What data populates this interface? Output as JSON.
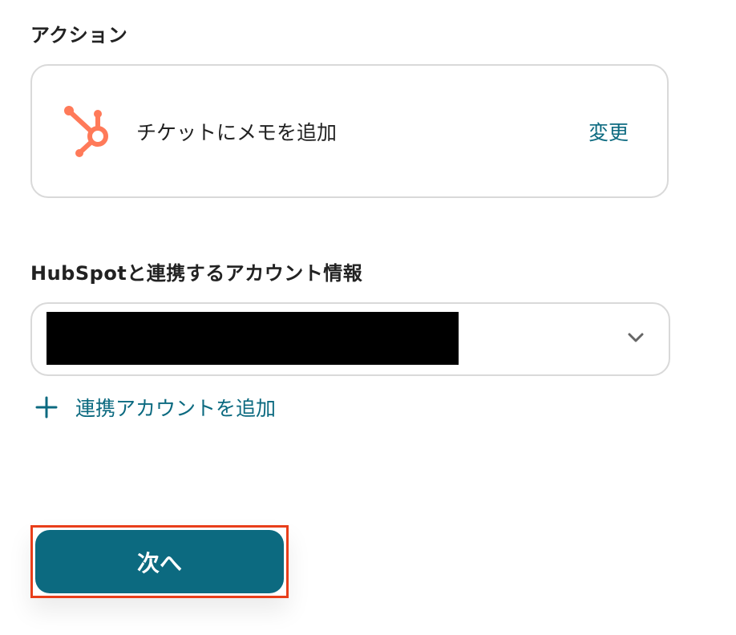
{
  "action_section": {
    "label": "アクション",
    "action_name": "チケットにメモを追加",
    "change_label": "変更",
    "app_icon": "hubspot-icon"
  },
  "account_section": {
    "label": "HubSpotと連携するアカウント情報",
    "add_account_label": "連携アカウントを追加"
  },
  "next_button": {
    "label": "次へ"
  },
  "colors": {
    "accent": "#0c6a80",
    "hubspot": "#ff7a59",
    "highlight_border": "#e83e1a",
    "border": "#d9d9d9"
  }
}
